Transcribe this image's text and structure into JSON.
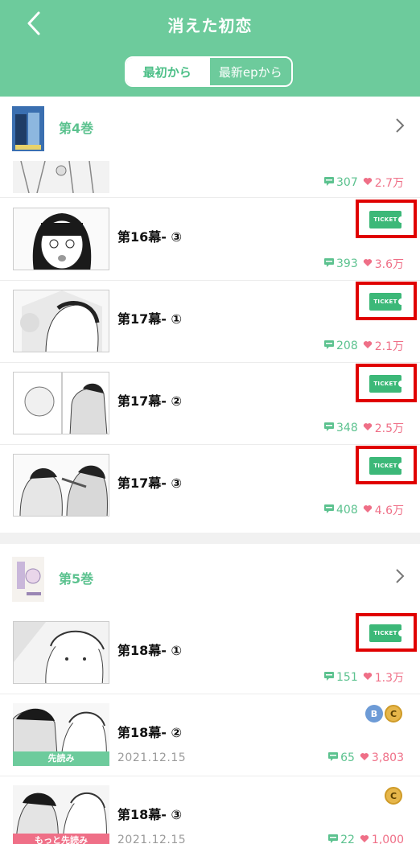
{
  "header": {
    "title": "消えた初恋",
    "seg_first": "最初から",
    "seg_latest": "最新epから"
  },
  "volumes": {
    "v4": "第4巻",
    "v5": "第5巻"
  },
  "partial_row": {
    "comments": "307",
    "likes": "2.7万"
  },
  "episodes": [
    {
      "title": "第16幕- ③",
      "comments": "393",
      "likes": "3.6万",
      "ticket": "TICKET"
    },
    {
      "title": "第17幕- ①",
      "comments": "208",
      "likes": "2.1万",
      "ticket": "TICKET"
    },
    {
      "title": "第17幕- ②",
      "comments": "348",
      "likes": "2.5万",
      "ticket": "TICKET"
    },
    {
      "title": "第17幕- ③",
      "comments": "408",
      "likes": "4.6万",
      "ticket": "TICKET"
    },
    {
      "title": "第18幕- ①",
      "comments": "151",
      "likes": "1.3万",
      "ticket": "TICKET"
    },
    {
      "title": "第18幕- ②",
      "comments": "65",
      "likes": "3,803",
      "date": "2021.12.15",
      "tag": "先読み",
      "badge1": "B",
      "badge2": "C"
    },
    {
      "title": "第18幕- ③",
      "comments": "22",
      "likes": "1,000",
      "date": "2021.12.15",
      "tag": "もっと先読み",
      "badge2": "C"
    }
  ],
  "colors": {
    "header": "#6dcb9c",
    "accent": "#5cc28f",
    "like": "#ef6f87",
    "highlight": "#e00000",
    "tag_green": "#6dcb9c",
    "tag_pink": "#ef6f87"
  }
}
